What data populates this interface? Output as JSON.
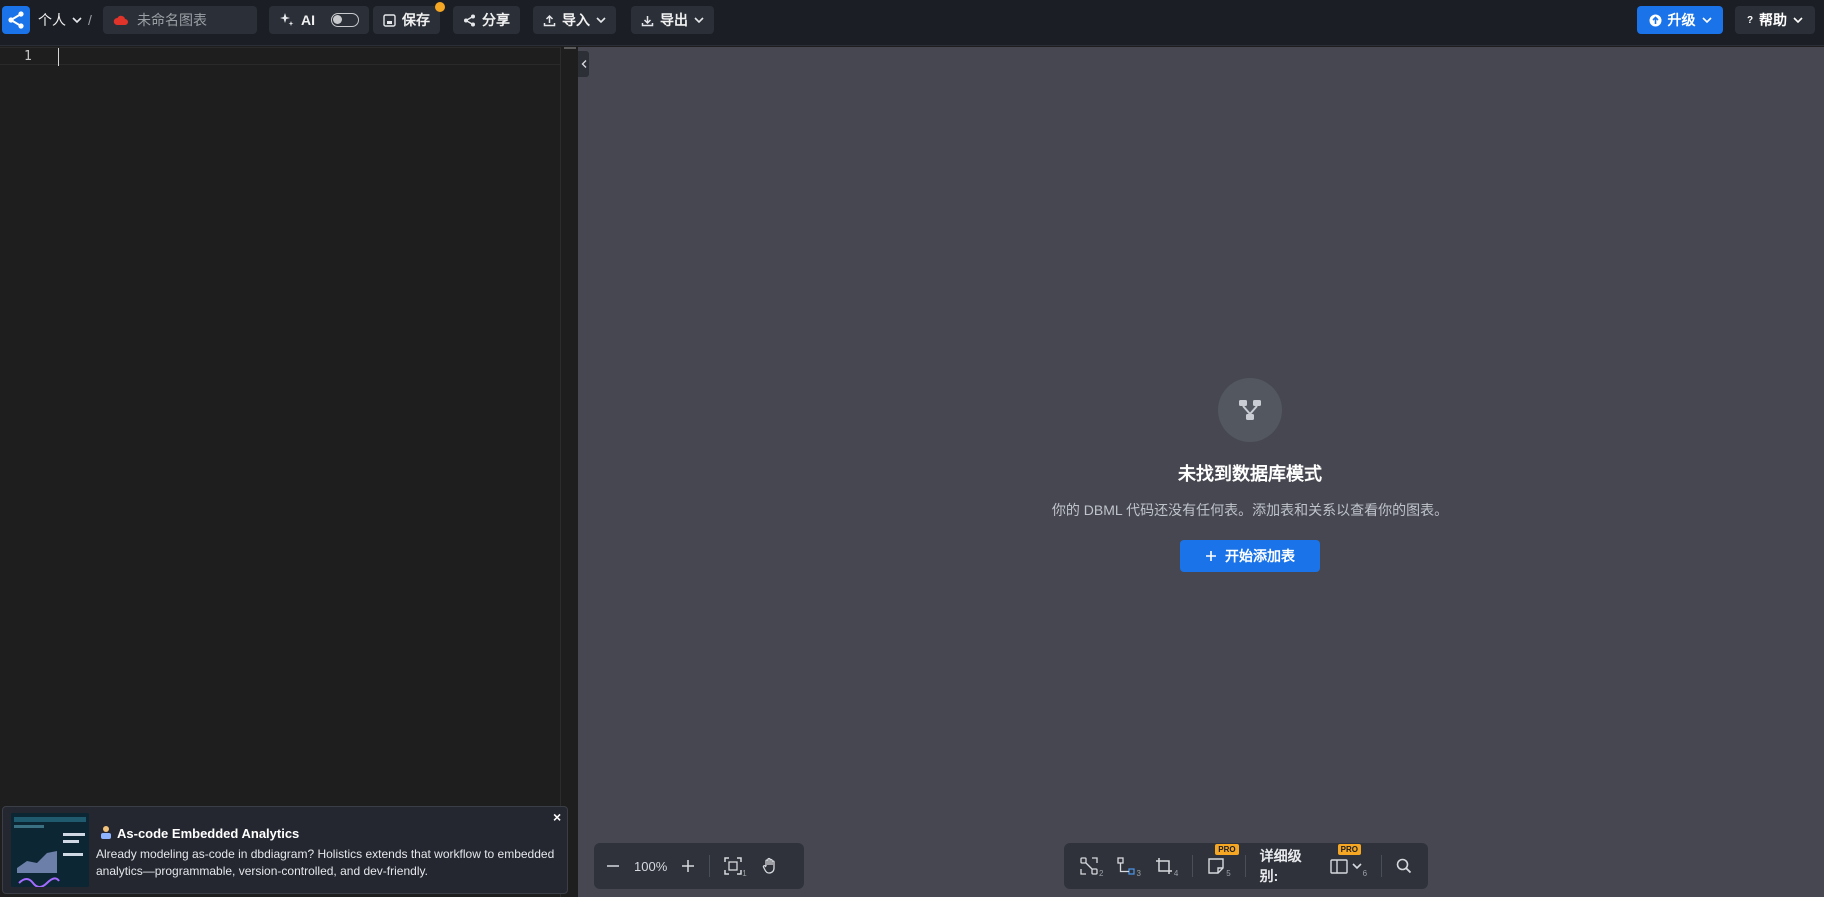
{
  "topbar": {
    "workspace": "个人",
    "separator": "/",
    "diagram_name_placeholder": "未命名图表",
    "ai_label": "AI",
    "save_label": "保存",
    "share_label": "分享",
    "import_label": "导入",
    "export_label": "导出",
    "upgrade_label": "升级",
    "help_label": "帮助"
  },
  "editor": {
    "line_numbers": [
      "1"
    ]
  },
  "empty_state": {
    "title": "未找到数据库模式",
    "description": "你的 DBML 代码还没有任何表。添加表和关系以查看你的图表。",
    "button_label": "开始添加表"
  },
  "zoom_toolbar": {
    "zoom_value": "100%",
    "fit_shortcut": "1"
  },
  "view_toolbar": {
    "shortcuts": [
      "2",
      "3",
      "4",
      "5",
      "6"
    ],
    "pro_badge": "PRO",
    "detail_level_label": "详细级别:"
  },
  "ad": {
    "title": "As-code Embedded Analytics",
    "body": "Already modeling as-code in dbdiagram? Holistics extends that workflow to embedded analytics—programmable, version-controlled, and dev-friendly.",
    "close": "×"
  },
  "colors": {
    "accent": "#1a73e8",
    "pro_badge": "#f5a623",
    "canvas_bg": "#474751",
    "editor_bg": "#1e1e1e"
  }
}
